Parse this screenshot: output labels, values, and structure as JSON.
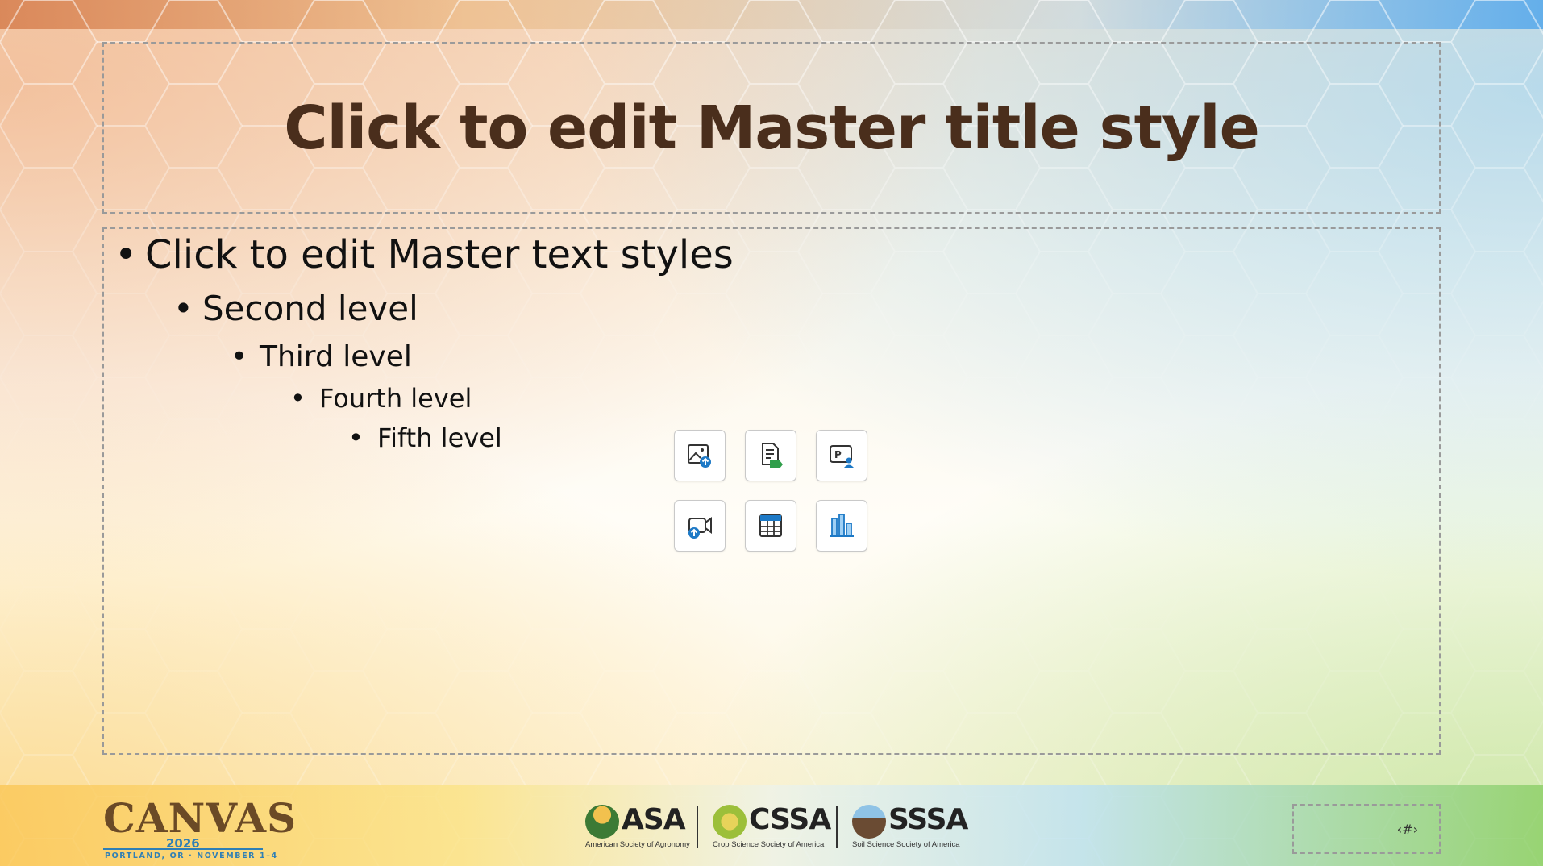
{
  "slide": {
    "title": "Click to edit Master title style",
    "body_levels": [
      "Click to edit Master text styles",
      "Second level",
      "Third level",
      "Fourth level",
      "Fifth level"
    ],
    "bullet": "•",
    "slide_number": "‹#›"
  },
  "insert_buttons": [
    {
      "icon": "insert-picture-icon"
    },
    {
      "icon": "insert-text-file-icon"
    },
    {
      "icon": "cameo-icon"
    },
    {
      "icon": "insert-video-icon"
    },
    {
      "icon": "insert-table-icon"
    },
    {
      "icon": "insert-chart-icon"
    }
  ],
  "footer": {
    "event_logo": {
      "word": "CANVAS",
      "year": "2026",
      "subtitle": "PORTLAND, OR · NOVEMBER 1–4"
    },
    "societies": [
      {
        "abbr": "ASA",
        "full": "American Society of Agronomy",
        "color": "#3c7a35"
      },
      {
        "abbr": "CSSA",
        "full": "Crop Science Society of America",
        "color": "#9cbf3a"
      },
      {
        "abbr": "SSSA",
        "full": "Soil Science Society of America",
        "color": "#5a84a8"
      }
    ]
  },
  "colors": {
    "title": "#4a2e1c",
    "accent_blue": "#2f7fb5",
    "accent_green": "#3aa04a"
  }
}
